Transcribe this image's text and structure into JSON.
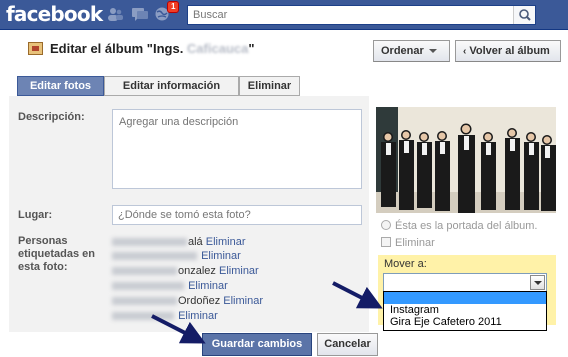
{
  "topbar": {
    "logo": "facebook",
    "notification_count": "1",
    "search_placeholder": "Buscar",
    "color": "#3b5998"
  },
  "header": {
    "title_prefix": "Editar el álbum \"Ings. ",
    "title_blurred": "Caficauca",
    "title_suffix": "\"",
    "order_button": "Ordenar",
    "back_button": "Volver al álbum"
  },
  "tabs": [
    {
      "label": "Editar fotos",
      "active": true
    },
    {
      "label": "Editar información",
      "active": false
    },
    {
      "label": "Eliminar",
      "active": false
    }
  ],
  "form": {
    "description_label": "Descripción:",
    "description_placeholder": "Agregar una descripción",
    "place_label": "Lugar:",
    "place_placeholder": "¿Dónde se tomó esta foto?",
    "tagged_label": "Personas etiquetadas en esta foto:",
    "tagged_people": [
      {
        "visible": "alá",
        "action": "Eliminar"
      },
      {
        "visible": "",
        "action": "Eliminar"
      },
      {
        "visible": "onzalez",
        "action": "Eliminar"
      },
      {
        "visible": "",
        "action": "Eliminar"
      },
      {
        "visible": "Ordoñez",
        "action": "Eliminar"
      },
      {
        "visible": "",
        "action": "Eliminar"
      }
    ]
  },
  "photo_options": {
    "cover_label": "Ésta es la portada del álbum.",
    "delete_label": "Eliminar",
    "move_label": "Mover a:",
    "dropdown_options": [
      "",
      "Instagram",
      "Gira Eje Cafetero 2011"
    ]
  },
  "footer": {
    "save_button": "Guardar cambios",
    "cancel_button": "Cancelar"
  }
}
